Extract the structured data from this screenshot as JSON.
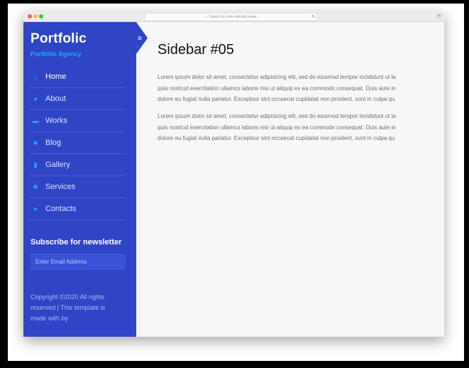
{
  "browser": {
    "address_placeholder": "Search or enter website name",
    "reload_icon": "reload-icon",
    "new_tab_icon": "plus-icon"
  },
  "sidebar": {
    "brand": "Portfolic",
    "tagline": "Portfolio Agency",
    "toggle_icon": "hamburger-menu-icon",
    "items": [
      {
        "label": "Home",
        "icon": "home-icon",
        "active": true
      },
      {
        "label": "About",
        "icon": "user-icon",
        "active": false
      },
      {
        "label": "Works",
        "icon": "briefcase-icon",
        "active": false
      },
      {
        "label": "Blog",
        "icon": "sticky-note-icon",
        "active": false
      },
      {
        "label": "Gallery",
        "icon": "suitcase-icon",
        "active": false
      },
      {
        "label": "Services",
        "icon": "cogs-icon",
        "active": false
      },
      {
        "label": "Contacts",
        "icon": "paper-plane-icon",
        "active": false
      }
    ],
    "newsletter_heading": "Subscribe for newsletter",
    "email_placeholder": "Enter Email Address",
    "copyright": "Copyright ©2020 All rights reserved | This template is made with by"
  },
  "main": {
    "title": "Sidebar #05",
    "paragraph1_lines": [
      "Lorem ipsum dolor sit amet, consectetur adipisicing elit, sed do eiusmod tempor incididunt ut la",
      "quis nostrud exercitation ullamco laboris nisi ut aliquip ex ea commodo consequat. Duis aute in",
      "dolore eu fugiat nulla pariatur. Excepteur sint occaecat cupidatat non proident, sunt in culpa qu"
    ],
    "paragraph2_lines": [
      "Lorem ipsum dolor sit amet, consectetur adipisicing elit, sed do eiusmod tempor incididunt ut la",
      "quis nostrud exercitation ullamco laboris nisi ut aliquip ex ea commodo consequat. Duis aute in",
      "dolore eu fugiat nulla pariatur. Excepteur sint occaecat cupidatat non proident, sunt in culpa qu"
    ]
  },
  "colors": {
    "sidebar": "#2f45c5",
    "accent": "#1fa7ff",
    "page_background": "#f7f7f9"
  }
}
